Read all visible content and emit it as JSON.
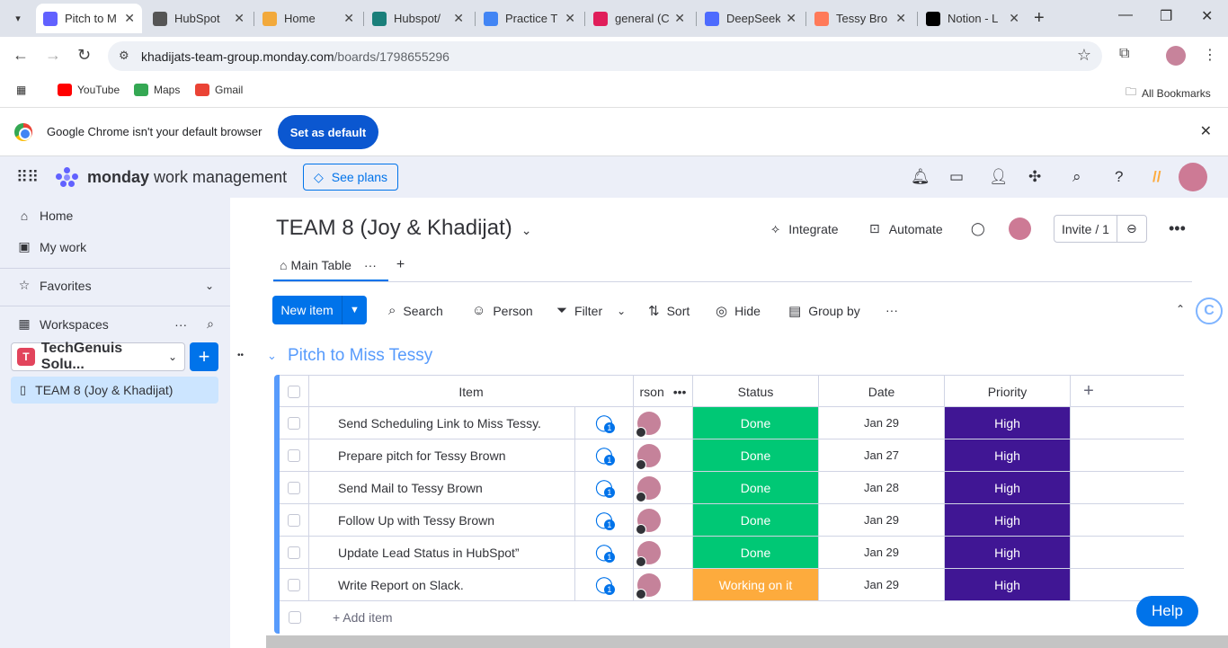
{
  "browser": {
    "tabs": [
      {
        "title": "Pitch to M",
        "active": true,
        "favicon_color": "#6161ff"
      },
      {
        "title": "HubSpot",
        "active": false,
        "favicon_color": "#555555"
      },
      {
        "title": "Home",
        "active": false,
        "favicon_color": "#f2a93b"
      },
      {
        "title": "Hubspot/",
        "active": false,
        "favicon_color": "#1a7f7a"
      },
      {
        "title": "Practice T",
        "active": false,
        "favicon_color": "#4285f4"
      },
      {
        "title": "general (C",
        "active": false,
        "favicon_color": "#e01e5a"
      },
      {
        "title": "DeepSeek",
        "active": false,
        "favicon_color": "#4d6bfe"
      },
      {
        "title": "Tessy Bro",
        "active": false,
        "favicon_color": "#ff7a59"
      },
      {
        "title": "Notion - L",
        "active": false,
        "favicon_color": "#000000"
      }
    ],
    "url_host": "khadijats-team-group.monday.com",
    "url_path": "/boards/1798655296",
    "bookmarks": [
      {
        "label": "YouTube",
        "color": "#ff0000"
      },
      {
        "label": "Maps",
        "color": "#34a853"
      },
      {
        "label": "Gmail",
        "color": "#ea4335"
      }
    ],
    "all_bookmarks": "All Bookmarks",
    "infobar": {
      "message": "Google Chrome isn't your default browser",
      "button": "Set as default"
    }
  },
  "app": {
    "brand_bold": "monday",
    "brand_rest": " work management",
    "see_plans": "See plans"
  },
  "sidebar": {
    "home": "Home",
    "my_work": "My work",
    "favorites": "Favorites",
    "workspaces": "Workspaces",
    "workspace_badge": "T",
    "workspace_name": "TechGenuis Solu...",
    "board": "TEAM 8 (Joy & Khadijat)"
  },
  "board": {
    "title": "TEAM 8 (Joy & Khadijat)",
    "integrate": "Integrate",
    "automate": "Automate",
    "invite": "Invite / 1",
    "view_tab": "Main Table",
    "toolbar": {
      "new_item": "New item",
      "search": "Search",
      "person": "Person",
      "filter": "Filter",
      "sort": "Sort",
      "hide": "Hide",
      "group_by": "Group by"
    },
    "group_title": "Pitch to Miss Tessy",
    "columns": {
      "item": "Item",
      "person": "rson",
      "status": "Status",
      "date": "Date",
      "priority": "Priority"
    },
    "rows": [
      {
        "item": "Send Scheduling Link to Miss Tessy.",
        "updates": "1",
        "status": "Done",
        "date": "Jan 29",
        "priority": "High"
      },
      {
        "item": "Prepare pitch for Tessy Brown",
        "updates": "1",
        "status": "Done",
        "date": "Jan 27",
        "priority": "High"
      },
      {
        "item": "Send Mail to Tessy Brown",
        "updates": "1",
        "status": "Done",
        "date": "Jan 28",
        "priority": "High"
      },
      {
        "item": "Follow Up with Tessy Brown",
        "updates": "1",
        "status": "Done",
        "date": "Jan 29",
        "priority": "High"
      },
      {
        "item": "Update Lead Status in HubSpot”",
        "updates": "1",
        "status": "Done",
        "date": "Jan 29",
        "priority": "High"
      },
      {
        "item": "Write Report on Slack.",
        "updates": "1",
        "status": "Working on it",
        "date": "Jan 29",
        "priority": "High"
      }
    ],
    "add_item": "+ Add item"
  },
  "help": "Help",
  "colors": {
    "accent": "#0073ea",
    "done": "#00c875",
    "working": "#fdab3d",
    "high": "#401694",
    "group": "#579bfc"
  }
}
